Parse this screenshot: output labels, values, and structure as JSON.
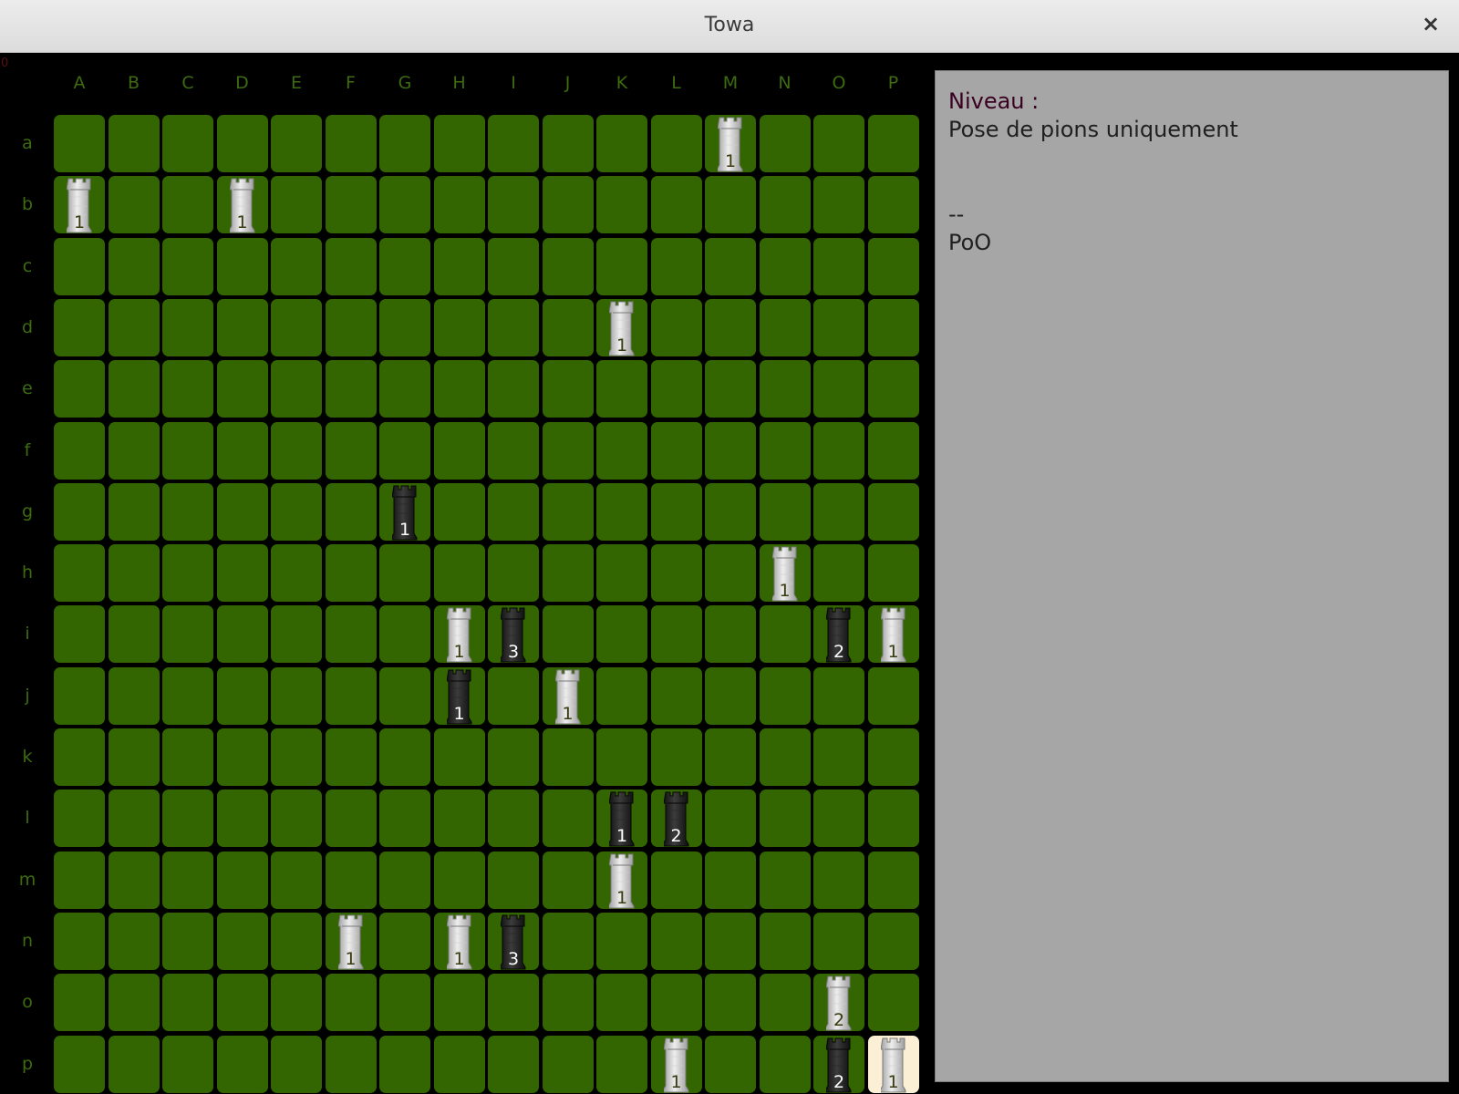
{
  "window": {
    "title": "Towa",
    "close_label": "×"
  },
  "corner_mark": "0",
  "board": {
    "columns": [
      "A",
      "B",
      "C",
      "D",
      "E",
      "F",
      "G",
      "H",
      "I",
      "J",
      "K",
      "L",
      "M",
      "N",
      "O",
      "P"
    ],
    "rows": [
      "a",
      "b",
      "c",
      "d",
      "e",
      "f",
      "g",
      "h",
      "i",
      "j",
      "k",
      "l",
      "m",
      "n",
      "o",
      "p"
    ],
    "highlighted": {
      "row": "p",
      "col": "P"
    },
    "pieces": [
      {
        "row": "a",
        "col": "M",
        "color": "white",
        "height": "1"
      },
      {
        "row": "b",
        "col": "A",
        "color": "white",
        "height": "1"
      },
      {
        "row": "b",
        "col": "D",
        "color": "white",
        "height": "1"
      },
      {
        "row": "d",
        "col": "K",
        "color": "white",
        "height": "1"
      },
      {
        "row": "g",
        "col": "G",
        "color": "black",
        "height": "1"
      },
      {
        "row": "h",
        "col": "N",
        "color": "white",
        "height": "1"
      },
      {
        "row": "i",
        "col": "H",
        "color": "white",
        "height": "1"
      },
      {
        "row": "i",
        "col": "I",
        "color": "black",
        "height": "3"
      },
      {
        "row": "i",
        "col": "O",
        "color": "black",
        "height": "2"
      },
      {
        "row": "i",
        "col": "P",
        "color": "white",
        "height": "1"
      },
      {
        "row": "j",
        "col": "H",
        "color": "black",
        "height": "1"
      },
      {
        "row": "j",
        "col": "J",
        "color": "white",
        "height": "1"
      },
      {
        "row": "l",
        "col": "K",
        "color": "black",
        "height": "1"
      },
      {
        "row": "l",
        "col": "L",
        "color": "black",
        "height": "2"
      },
      {
        "row": "m",
        "col": "K",
        "color": "white",
        "height": "1"
      },
      {
        "row": "n",
        "col": "F",
        "color": "white",
        "height": "1"
      },
      {
        "row": "n",
        "col": "H",
        "color": "white",
        "height": "1"
      },
      {
        "row": "n",
        "col": "I",
        "color": "black",
        "height": "3"
      },
      {
        "row": "o",
        "col": "O",
        "color": "white",
        "height": "2"
      },
      {
        "row": "p",
        "col": "L",
        "color": "white",
        "height": "1"
      },
      {
        "row": "p",
        "col": "O",
        "color": "black",
        "height": "2"
      },
      {
        "row": "p",
        "col": "P",
        "color": "white",
        "height": "1"
      }
    ]
  },
  "info_panel": {
    "level_label": "Niveau :",
    "level_value": "",
    "mode": "Pose de pions uniquement",
    "separator": "--",
    "player": "PoO"
  }
}
